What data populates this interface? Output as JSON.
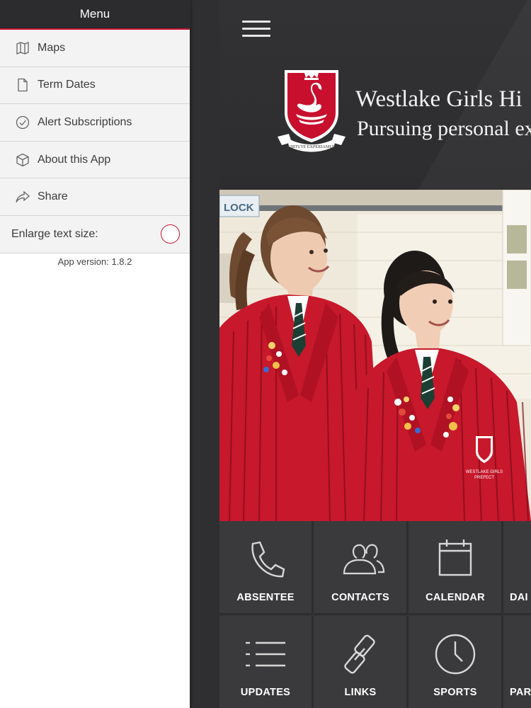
{
  "menu": {
    "title": "Menu",
    "items": [
      {
        "label": "Maps",
        "icon": "map-icon"
      },
      {
        "label": "Term Dates",
        "icon": "document-icon"
      },
      {
        "label": "Alert Subscriptions",
        "icon": "check-circle-icon"
      },
      {
        "label": "About this App",
        "icon": "cube-icon"
      },
      {
        "label": "Share",
        "icon": "share-icon"
      }
    ],
    "enlarge_text_label": "Enlarge text size:",
    "enlarge_text_enabled": false,
    "app_version": "App version: 1.8.2"
  },
  "header": {
    "school_name": "Westlake Girls Hi",
    "motto": "Pursuing personal ex",
    "crest_motto": "VIRTUTE EXPERIAMUR"
  },
  "hero": {
    "sign_text": "LOCK",
    "badge_text_line1": "WESTLAKE GIRLS",
    "badge_text_line2": "PREFECT"
  },
  "tiles": [
    {
      "label": "ABSENTEE",
      "icon": "phone-icon"
    },
    {
      "label": "CONTACTS",
      "icon": "contacts-icon"
    },
    {
      "label": "CALENDAR",
      "icon": "calendar-icon"
    },
    {
      "label": "DAI",
      "icon": "daily-icon"
    },
    {
      "label": "UPDATES",
      "icon": "list-icon"
    },
    {
      "label": "LINKS",
      "icon": "link-icon"
    },
    {
      "label": "SPORTS",
      "icon": "clock-icon"
    },
    {
      "label": "PAR",
      "icon": "parent-icon"
    }
  ],
  "colors": {
    "accent": "#c8102e",
    "header_bg": "#2c2c2e",
    "tile_bg": "#3a3a3c",
    "menu_bg": "#f3f3f3"
  }
}
